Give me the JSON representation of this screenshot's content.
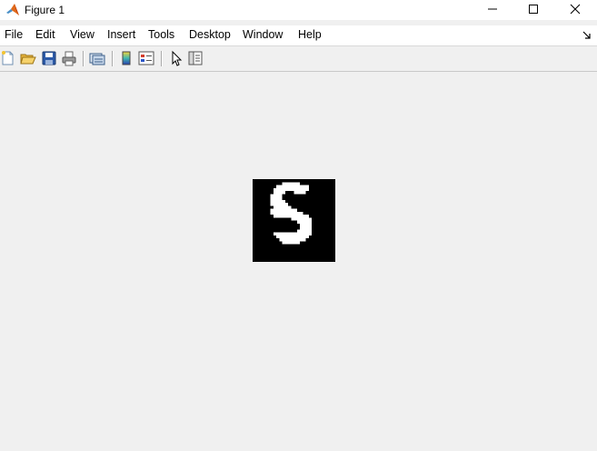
{
  "window": {
    "title": "Figure 1",
    "icon": "matlab-logo-icon",
    "controls": [
      "minimize-icon",
      "maximize-icon",
      "close-icon"
    ]
  },
  "menu": {
    "items": [
      "File",
      "Edit",
      "View",
      "Insert",
      "Tools",
      "Desktop",
      "Window",
      "Help"
    ]
  },
  "toolbar": {
    "tools": [
      "new-figure-icon",
      "open-file-icon",
      "save-icon",
      "print-icon",
      "link-plot-icon",
      "insert-colorbar-icon",
      "insert-legend-icon",
      "edit-plot-pointer-icon",
      "property-inspector-icon"
    ]
  },
  "figure": {
    "content": "grayscale-image-handwritten-digit",
    "image_colors": {
      "background": "#000000",
      "foreground": "#ffffff"
    }
  },
  "colors": {
    "window_bg": "#f0f0f0",
    "titlebar_bg": "#ffffff"
  }
}
